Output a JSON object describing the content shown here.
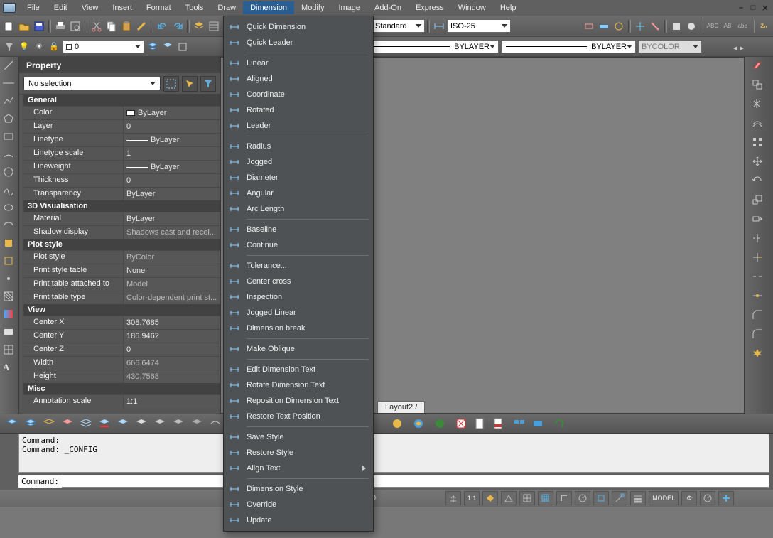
{
  "menu": {
    "items": [
      "File",
      "Edit",
      "View",
      "Insert",
      "Format",
      "Tools",
      "Draw",
      "Dimension",
      "Modify",
      "Image",
      "Add-On",
      "Express",
      "Window",
      "Help"
    ],
    "active": "Dimension"
  },
  "dropdown": [
    {
      "label": "Quick Dimension"
    },
    {
      "label": "Quick Leader"
    },
    {
      "sep": true
    },
    {
      "label": "Linear"
    },
    {
      "label": "Aligned"
    },
    {
      "label": "Coordinate"
    },
    {
      "label": "Rotated"
    },
    {
      "label": "Leader"
    },
    {
      "sep": true
    },
    {
      "label": "Radius"
    },
    {
      "label": "Jogged"
    },
    {
      "label": "Diameter"
    },
    {
      "label": "Angular"
    },
    {
      "label": "Arc Length"
    },
    {
      "sep": true
    },
    {
      "label": "Baseline"
    },
    {
      "label": "Continue"
    },
    {
      "sep": true
    },
    {
      "label": "Tolerance..."
    },
    {
      "label": "Center cross"
    },
    {
      "label": "Inspection"
    },
    {
      "label": "Jogged Linear"
    },
    {
      "label": "Dimension break"
    },
    {
      "sep": true
    },
    {
      "label": "Make Oblique"
    },
    {
      "sep": true
    },
    {
      "label": "Edit Dimension Text"
    },
    {
      "label": "Rotate Dimension Text"
    },
    {
      "label": "Reposition Dimension Text"
    },
    {
      "label": "Restore Text Position"
    },
    {
      "sep": true
    },
    {
      "label": "Save Style"
    },
    {
      "label": "Restore Style"
    },
    {
      "label": "Align Text",
      "sub": true
    },
    {
      "sep": true
    },
    {
      "label": "Dimension Style"
    },
    {
      "label": "Override"
    },
    {
      "label": "Update"
    }
  ],
  "toolbar1": {
    "dimstyle": "Standard",
    "iso": "ISO-25"
  },
  "layerbar": {
    "layer": "0",
    "bylayerCombo": "BYLAYER",
    "bylayerCombo2": "BYLAYER",
    "bycolor": "BYCOLOR"
  },
  "panel": {
    "title": "Property",
    "selection": "No selection",
    "sections": [
      {
        "name": "General",
        "rows": [
          {
            "k": "Color",
            "v": "ByLayer",
            "swatch": true
          },
          {
            "k": "Layer",
            "v": "0"
          },
          {
            "k": "Linetype",
            "v": "ByLayer",
            "line": true
          },
          {
            "k": "Linetype scale",
            "v": "1"
          },
          {
            "k": "Lineweight",
            "v": "ByLayer",
            "line": true
          },
          {
            "k": "Thickness",
            "v": "0"
          },
          {
            "k": "Transparency",
            "v": "ByLayer"
          }
        ]
      },
      {
        "name": "3D Visualisation",
        "rows": [
          {
            "k": "Material",
            "v": "ByLayer"
          },
          {
            "k": "Shadow display",
            "v": "Shadows cast and recei...",
            "dim": true
          }
        ]
      },
      {
        "name": "Plot style",
        "rows": [
          {
            "k": "Plot style",
            "v": "ByColor",
            "dim": true
          },
          {
            "k": "Print style table",
            "v": "None"
          },
          {
            "k": "Print table attached to",
            "v": "Model",
            "dim": true
          },
          {
            "k": "Print table type",
            "v": "Color-dependent print st...",
            "dim": true
          }
        ]
      },
      {
        "name": "View",
        "rows": [
          {
            "k": "Center X",
            "v": "308.7685"
          },
          {
            "k": "Center Y",
            "v": "186.9462"
          },
          {
            "k": "Center Z",
            "v": "0"
          },
          {
            "k": "Width",
            "v": "666.6474",
            "dim": true
          },
          {
            "k": "Height",
            "v": "430.7568",
            "dim": true
          }
        ]
      },
      {
        "name": "Misc",
        "rows": [
          {
            "k": "Annotation scale",
            "v": "1:1"
          }
        ]
      }
    ]
  },
  "tabs": {
    "layout2": "Layout2"
  },
  "cmd": {
    "history": "Command:\nCommand: _CONFIG",
    "prompt": "Command:"
  },
  "status": {
    "coord": ".0",
    "ratio": "1:1",
    "model": "MODEL"
  }
}
